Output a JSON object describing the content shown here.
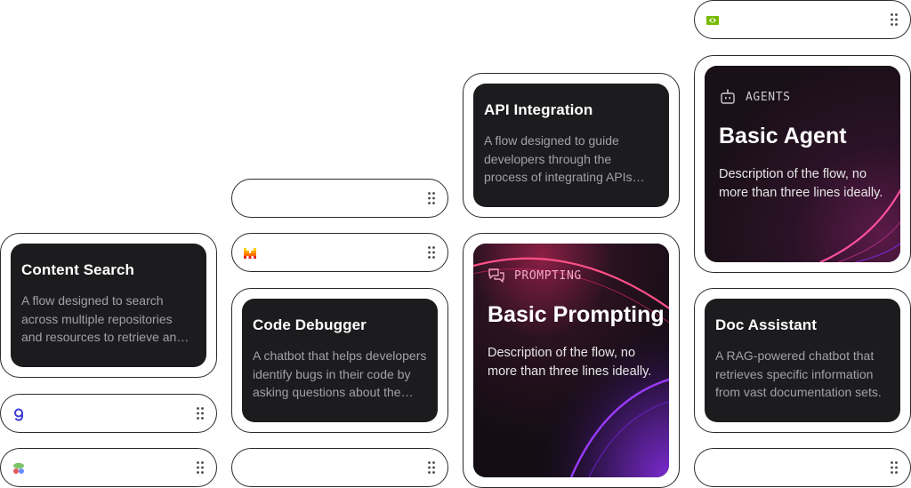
{
  "cards": {
    "content_search": {
      "title": "Content Search",
      "description": "A flow designed to search across multiple repositories and resources to retrieve and present relevant content."
    },
    "code_debugger": {
      "title": "Code Debugger",
      "description": "A chatbot that helps developers identify bugs in their code by asking questions about the issue."
    },
    "api_integration": {
      "title": "API Integration",
      "description": "A flow designed to guide developers through the process of integrating APIs effectively."
    },
    "doc_assistant": {
      "title": "Doc Assistant",
      "description": "A RAG-powered chatbot that retrieves specific information from vast documentation sets."
    }
  },
  "featured": {
    "prompting": {
      "tag": "PROMPTING",
      "title": "Basic Prompting",
      "description": "Description of the flow, no more than three lines ideally."
    },
    "agents": {
      "tag": "AGENTS",
      "title": "Basic Agent",
      "description": "Description of the flow, no more than three lines ideally."
    }
  },
  "pills": [
    {
      "icon": "nvidia-logo-icon"
    },
    {
      "icon": "empty"
    },
    {
      "icon": "mistral-logo-icon"
    },
    {
      "icon": "groq-logo-icon"
    },
    {
      "icon": "multicolor-logo-icon"
    },
    {
      "icon": "empty"
    },
    {
      "icon": "empty"
    }
  ],
  "colors": {
    "card_bg": "#1c1c1e",
    "pink_accent": "#e0336e",
    "purple_accent": "#8a2be2",
    "nvidia_green": "#76b900",
    "mistral_orange": "#ff7000",
    "groq_blue": "#3a3ad6"
  }
}
